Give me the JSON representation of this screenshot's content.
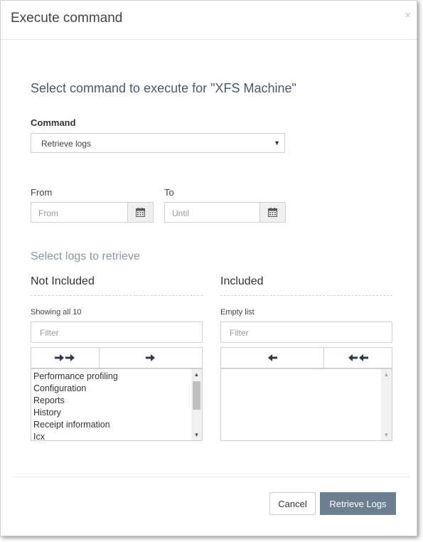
{
  "dialog": {
    "title": "Execute command",
    "close_glyph": "×"
  },
  "subheading": "Select command to execute for \"XFS Machine\"",
  "command": {
    "label": "Command",
    "selected": "Retrieve logs",
    "caret_glyph": "▼"
  },
  "from": {
    "label": "From",
    "placeholder": "From",
    "icon": "calendar-icon"
  },
  "to": {
    "label": "To",
    "placeholder": "Until",
    "icon": "calendar-icon"
  },
  "logs": {
    "section_title": "Select logs to retrieve",
    "not_included": {
      "title": "Not Included",
      "status": "Showing all 10",
      "filter_placeholder": "Filter",
      "buttons": [
        "move-all-right-icon",
        "move-right-icon"
      ],
      "items": [
        "Performance profiling",
        "Configuration",
        "Reports",
        "History",
        "Receipt information",
        "Icx"
      ]
    },
    "included": {
      "title": "Included",
      "status": "Empty list",
      "filter_placeholder": "Filter",
      "buttons": [
        "move-left-icon",
        "move-all-left-icon"
      ],
      "items": []
    }
  },
  "footer": {
    "cancel_label": "Cancel",
    "submit_label": "Retrieve Logs"
  },
  "colors": {
    "primary_button": "#6c7f91",
    "border": "#cfcfcf",
    "arrow": "#2b3a4a"
  }
}
